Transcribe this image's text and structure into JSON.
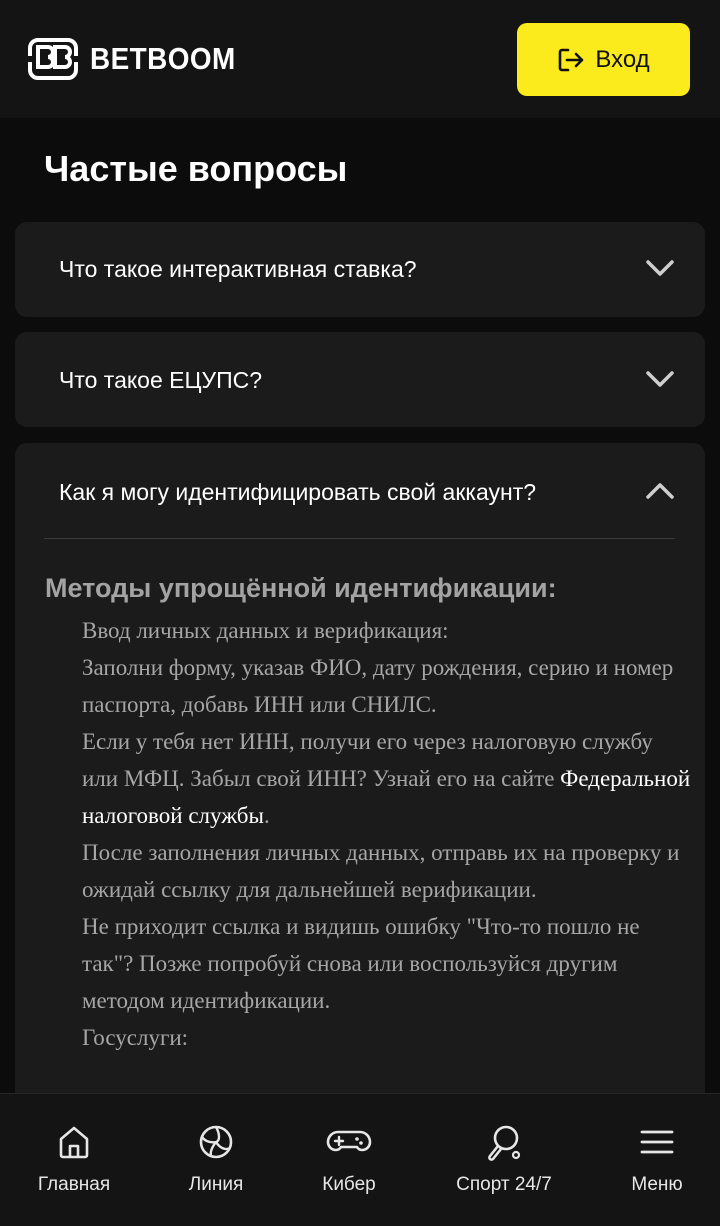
{
  "header": {
    "brand": "BETBOOM",
    "login_label": "Вход"
  },
  "page": {
    "title": "Частые вопросы"
  },
  "faq": [
    {
      "question": "Что такое интерактивная ставка?",
      "expanded": false
    },
    {
      "question": "Что такое ЕЦУПС?",
      "expanded": false
    },
    {
      "question": "Как я могу идентифицировать свой аккаунт?",
      "expanded": true
    }
  ],
  "answer": {
    "title": "Методы упрощённой идентификации:",
    "p1": "Ввод личных данных и верификация:",
    "p2": "Заполни форму, указав ФИО, дату рождения, серию и номер паспорта, добавь ИНН или СНИЛС.",
    "p3_before": "Если у тебя нет ИНН, получи его через налоговую службу или МФЦ. Забыл свой ИНН? Узнай его на сайте ",
    "p3_link": "Федеральной налоговой службы",
    "p3_after": ".",
    "p4": "После заполнения личных данных, отправь их на проверку и ожидай ссылку для дальнейшей верификации.",
    "p5": "Не приходит ссылка и видишь ошибку \"Что-то пошло не так\"? Позже попробуй снова или воспользуйся другим методом идентификации.",
    "p6": "Госуслуги:"
  },
  "nav": [
    {
      "label": "Главная",
      "icon": "home-icon"
    },
    {
      "label": "Линия",
      "icon": "volleyball-icon"
    },
    {
      "label": "Кибер",
      "icon": "gamepad-icon"
    },
    {
      "label": "Спорт 24/7",
      "icon": "ping-pong-icon"
    },
    {
      "label": "Меню",
      "icon": "menu-icon"
    }
  ],
  "colors": {
    "accent": "#fbea1c",
    "background": "#0c0c0c",
    "card": "#1b1b1b",
    "header": "#141414"
  }
}
